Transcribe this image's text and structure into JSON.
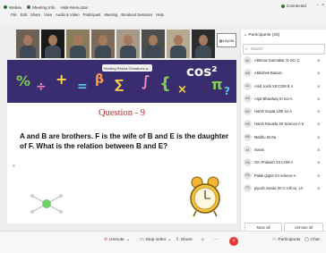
{
  "titlebar": {
    "tabs": [
      "Webex",
      "Meeting Info",
      "Hide Menu Bar"
    ],
    "connected": "Connected"
  },
  "menubar": [
    "File",
    "Edit",
    "Share",
    "View",
    "Audio & Video",
    "Participant",
    "Meeting",
    "Breakout Sessions",
    "Help"
  ],
  "layout_label": "Layout",
  "viewing_banner": "Viewing Rekha Chhabra's a...",
  "banner_symbols": [
    "%",
    "÷",
    "+",
    "=",
    "cos²",
    "β",
    "{",
    "∑",
    "∫",
    "×",
    "π",
    "?"
  ],
  "slide": {
    "title": "Question - 9",
    "question": "A and B are brothers. F is the wife of B and E is the daughter of F. What is the relation between B and E?"
  },
  "controls": [
    "Unmute",
    "Stop video",
    "Share"
  ],
  "participants": {
    "title": "Participants (25)",
    "search_placeholder": "Search",
    "list": [
      {
        "initials": "AC",
        "name": "Abhinav Karmakar XI SCI C"
      },
      {
        "initials": "AB",
        "name": "Abhishek Bansal"
      },
      {
        "initials": "AJ",
        "name": "Amit Joshi XII COM B 4"
      },
      {
        "initials": "AS",
        "name": "Arpit Bhardwaj XI Sci-A"
      },
      {
        "initials": "HG",
        "name": "Harsh Gupta 12th sci A"
      },
      {
        "initials": "HR",
        "name": "Harsh Rautela XII Science A 9"
      },
      {
        "initials": "MS",
        "name": "Madhu Sinha"
      },
      {
        "initials": "M",
        "name": "manin"
      },
      {
        "initials": "OA",
        "name": "Om Prakash XII COM A"
      },
      {
        "initials": "PA",
        "name": "Palak gupta XII science A"
      },
      {
        "initials": "PJ",
        "name": "piyush narula XII-C roll no. 13"
      }
    ],
    "mute_all": "Mute all",
    "unmute_all": "Unmute all"
  },
  "bottom_right": {
    "participants": "Participants",
    "chat": "Chat"
  }
}
